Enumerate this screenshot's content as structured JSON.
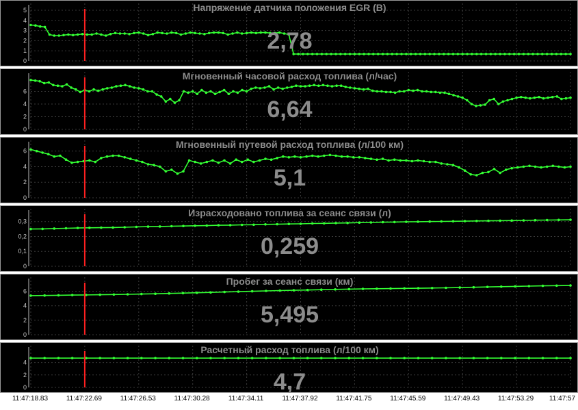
{
  "x_labels": [
    "11:47:18.83",
    "11:47:22.69",
    "11:47:26.53",
    "11:47:30.28",
    "11:47:34.11",
    "11:47:37.92",
    "11:47:41.75",
    "11:47:45.59",
    "11:47:49.43",
    "11:47:53.29",
    "11:47:57"
  ],
  "cursor_x": "11:47:22.69",
  "colors": {
    "line": "#33ff33",
    "cursor": "#ff2020",
    "grid": "#3a3a3a",
    "tick": "#c8c8c8",
    "text": "#8c8c8c",
    "panel_bg": "#000000"
  },
  "chart_data": [
    {
      "type": "line",
      "title": "Напряжение датчика положения EGR  (В)",
      "value": "2,78",
      "ylim": [
        0,
        5
      ],
      "yticks": [
        "0",
        "1",
        "2",
        "3",
        "4",
        "5"
      ],
      "values": [
        3.55,
        3.5,
        3.4,
        3.35,
        2.6,
        2.5,
        2.5,
        2.55,
        2.6,
        2.55,
        2.6,
        2.65,
        2.6,
        2.6,
        2.7,
        2.6,
        2.5,
        2.65,
        2.75,
        2.7,
        2.7,
        2.65,
        2.75,
        2.8,
        2.7,
        2.55,
        2.65,
        2.8,
        2.75,
        2.7,
        2.8,
        2.75,
        2.6,
        2.7,
        2.8,
        2.75,
        2.7,
        2.65,
        2.75,
        2.8,
        2.8,
        2.75,
        2.6,
        2.7,
        2.8,
        2.7,
        2.75,
        2.8,
        2.75,
        2.8,
        2.8,
        2.75,
        2.75,
        2.8,
        2.7,
        2.6,
        0.68,
        0.68,
        0.68,
        0.68,
        0.68,
        0.68,
        0.68,
        0.68,
        0.68,
        0.68,
        0.68,
        0.68,
        0.68,
        0.68,
        0.68,
        0.68,
        0.68,
        0.68,
        0.68,
        0.68,
        0.68,
        0.68,
        0.68,
        0.68,
        0.68,
        0.68,
        0.68,
        0.68,
        0.68,
        0.68,
        0.68,
        0.68,
        0.68,
        0.68,
        0.68,
        0.68,
        0.68,
        0.68,
        0.68,
        0.68,
        0.68,
        0.68,
        0.68,
        0.68,
        0.68,
        0.68,
        0.68,
        0.68,
        0.68,
        0.68,
        0.68,
        0.68,
        0.68,
        0.68,
        0.68,
        0.68,
        0.68,
        0.68,
        0.68,
        0.68
      ]
    },
    {
      "type": "line",
      "title": "Мгновенный часовой расход топлива  (л/час)",
      "value": "6,64",
      "ylim": [
        0,
        8
      ],
      "yticks": [
        "0",
        "2",
        "4",
        "6"
      ],
      "values": [
        7.8,
        7.7,
        7.6,
        7.3,
        7.4,
        7.0,
        6.9,
        6.8,
        7.1,
        6.6,
        6.3,
        5.9,
        6.2,
        6.0,
        6.3,
        6.1,
        6.3,
        6.5,
        6.6,
        6.8,
        6.9,
        7.0,
        6.8,
        6.6,
        6.5,
        6.3,
        6.0,
        6.0,
        5.5,
        5.2,
        4.4,
        4.8,
        4.2,
        4.6,
        6.0,
        5.8,
        6.0,
        5.6,
        6.2,
        5.8,
        6.0,
        5.6,
        5.9,
        6.2,
        5.6,
        6.0,
        5.8,
        6.2,
        6.0,
        6.4,
        6.6,
        6.5,
        6.6,
        6.8,
        6.3,
        6.6,
        6.4,
        6.6,
        6.7,
        6.9,
        6.8,
        6.8,
        6.9,
        7.0,
        6.9,
        7.0,
        6.9,
        6.8,
        6.9,
        6.9,
        6.7,
        6.6,
        6.5,
        6.4,
        6.3,
        6.4,
        6.1,
        6.0,
        6.0,
        5.9,
        5.9,
        5.8,
        6.0,
        6.0,
        6.2,
        6.1,
        6.2,
        6.0,
        6.0,
        5.9,
        5.9,
        5.8,
        5.8,
        5.6,
        5.4,
        5.2,
        5.0,
        4.6,
        4.0,
        3.7,
        3.8,
        3.9,
        4.6,
        4.8,
        4.0,
        4.4,
        4.6,
        4.8,
        5.0,
        5.1,
        5.0,
        4.9,
        5.0,
        5.1,
        4.9,
        5.0,
        5.1,
        5.2,
        4.8,
        4.9,
        5.0
      ]
    },
    {
      "type": "line",
      "title": "Мгновенный путевой расход топлива  (л/100 км)",
      "value": "5,1",
      "ylim": [
        0,
        6.5
      ],
      "yticks": [
        "0",
        "2",
        "4",
        "6"
      ],
      "values": [
        6.2,
        6.0,
        5.8,
        5.6,
        5.3,
        5.4,
        4.9,
        4.5,
        4.6,
        4.7,
        4.8,
        4.6,
        5.1,
        5.3,
        5.4,
        5.4,
        5.2,
        5.0,
        4.8,
        4.6,
        4.3,
        4.2,
        4.0,
        3.4,
        3.6,
        3.1,
        3.4,
        4.8,
        4.6,
        4.4,
        4.6,
        4.8,
        4.5,
        4.8,
        4.4,
        4.9,
        4.6,
        4.9,
        4.6,
        4.8,
        5.0,
        4.9,
        5.1,
        5.3,
        5.2,
        5.3,
        5.2,
        5.3,
        5.4,
        5.3,
        5.4,
        5.5,
        5.4,
        5.3,
        5.3,
        5.2,
        5.2,
        5.1,
        5.0,
        4.9,
        5.0,
        4.8,
        4.9,
        4.8,
        4.8,
        4.7,
        4.8,
        4.7,
        4.6,
        4.6,
        4.4,
        4.3,
        4.2,
        3.9,
        3.5,
        3.0,
        2.9,
        3.2,
        3.3,
        3.7,
        3.2,
        3.6,
        3.8,
        3.9,
        4.0,
        4.1,
        4.0,
        3.9,
        4.0,
        4.1,
        4.0,
        3.9,
        4.0
      ]
    },
    {
      "type": "line",
      "title": "Израсходовано топлива за сеанс связи  (л)",
      "value": "0,259",
      "ylim": [
        0,
        0.34
      ],
      "yticks": [
        "0",
        "0,1",
        "0,2",
        "0,3"
      ],
      "values": [
        0.25,
        0.251,
        0.253,
        0.255,
        0.257,
        0.258,
        0.259,
        0.26,
        0.262,
        0.264,
        0.266,
        0.267,
        0.269,
        0.27,
        0.272,
        0.273,
        0.275,
        0.276,
        0.278,
        0.279,
        0.281,
        0.282,
        0.284,
        0.285,
        0.287,
        0.288,
        0.29,
        0.291,
        0.293,
        0.294,
        0.296,
        0.297,
        0.298,
        0.299,
        0.3,
        0.301,
        0.302,
        0.303,
        0.304,
        0.305,
        0.306,
        0.307,
        0.308,
        0.309,
        0.31,
        0.311,
        0.312
      ]
    },
    {
      "type": "line",
      "title": "Пробег за сеанс связи  (км)",
      "value": "5,495",
      "ylim": [
        0,
        7
      ],
      "yticks": [
        "0",
        "2",
        "4",
        "6"
      ],
      "values": [
        5.4,
        5.42,
        5.45,
        5.48,
        5.5,
        5.52,
        5.55,
        5.58,
        5.62,
        5.66,
        5.7,
        5.75,
        5.8,
        5.85,
        5.9,
        5.95,
        6.0,
        6.05,
        6.1,
        6.14,
        6.18,
        6.22,
        6.26,
        6.3,
        6.33,
        6.36,
        6.38,
        6.4,
        6.42,
        6.45,
        6.48,
        6.52,
        6.56,
        6.6,
        6.64,
        6.68,
        6.72,
        6.75,
        6.78,
        6.8
      ]
    },
    {
      "type": "line",
      "title": "Расчетный расход топлива  (л/100 км)",
      "value": "4,7",
      "ylim": [
        0,
        5.6
      ],
      "yticks": [
        "0",
        "2",
        "4"
      ],
      "values": [
        4.7,
        4.7,
        4.7,
        4.7,
        4.7,
        4.7,
        4.7,
        4.7,
        4.7,
        4.7,
        4.7,
        4.7,
        4.7,
        4.7,
        4.7,
        4.7,
        4.7,
        4.7,
        4.7,
        4.7,
        4.7,
        4.7,
        4.7,
        4.7,
        4.7,
        4.7,
        4.7,
        4.7,
        4.7,
        4.7,
        4.7,
        4.7,
        4.7,
        4.7,
        4.7,
        4.7,
        4.7,
        4.7,
        4.7,
        4.7
      ]
    }
  ]
}
